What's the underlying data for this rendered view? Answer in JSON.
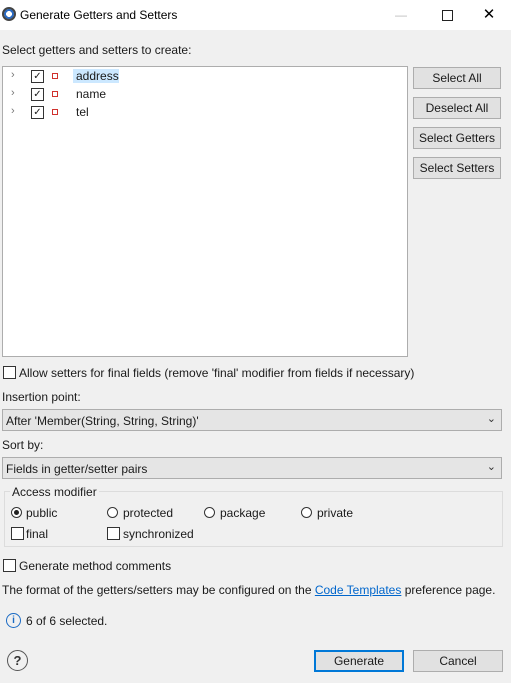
{
  "window": {
    "title": "Generate Getters and Setters",
    "min": "—",
    "close": "✕"
  },
  "select_label": "Select getters and setters to create:",
  "tree": {
    "items": [
      {
        "label": "address",
        "checked": true
      },
      {
        "label": "name",
        "checked": true
      },
      {
        "label": "tel",
        "checked": true
      }
    ],
    "chevron": "›",
    "check_mark": "✓"
  },
  "side_buttons": {
    "select_all": "Select All",
    "deselect_all": "Deselect All",
    "select_getters": "Select Getters",
    "select_setters": "Select Setters"
  },
  "allow_final": "Allow setters for final fields (remove 'final' modifier from fields if necessary)",
  "insertion_point": {
    "label": "Insertion point:",
    "value": "After 'Member(String, String, String)'"
  },
  "sort_by": {
    "label": "Sort by:",
    "value": "Fields in getter/setter pairs"
  },
  "access": {
    "title": "Access modifier",
    "options": [
      "public",
      "protected",
      "package",
      "private"
    ],
    "selected": "public",
    "final": "final",
    "synchronized": "synchronized"
  },
  "generate_comments": "Generate method comments",
  "format_text_before": "The format of the getters/setters may be configured on the",
  "format_link": "Code Templates",
  "format_text_after": "preference page.",
  "status": "6 of 6 selected.",
  "status_icon": "i",
  "help_icon": "?",
  "buttons": {
    "generate": "Generate",
    "cancel": "Cancel"
  },
  "combo_arrow": "⌄"
}
